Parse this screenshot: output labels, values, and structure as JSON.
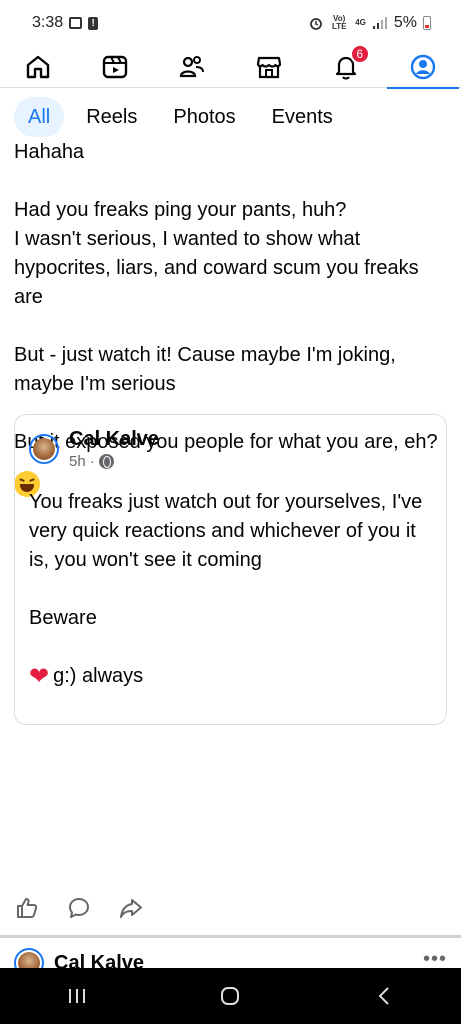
{
  "status_bar": {
    "time": "3:38",
    "network_label": "Vo) LTE",
    "network_type": "4G",
    "battery_percent": "5%"
  },
  "nav": {
    "items": [
      "home-icon",
      "reels-icon",
      "friends-icon",
      "marketplace-icon",
      "notifications-icon",
      "profile-icon"
    ],
    "active": "profile-icon",
    "notification_count": "6",
    "accent_color": "#1877f2"
  },
  "filters": {
    "chips": [
      "All",
      "Reels",
      "Photos",
      "Events"
    ],
    "active": "All"
  },
  "post": {
    "lines": {
      "p0": "Hahaha",
      "p1": "Had you freaks ping your pants, huh?",
      "p2": "I wasn't serious, I wanted to show what hypocrites, liars, and coward scum you freaks are",
      "p3": "But - just watch it! Cause maybe I'm joking,  maybe I'm serious",
      "p4": "But it exposed you people for what you are, eh?"
    },
    "emoji": "laughing-face-emoji"
  },
  "shared_post": {
    "author": "Cal Kalve",
    "time": "5h",
    "separator": "·",
    "lines": {
      "p1": "You freaks just watch out for yourselves, I've very quick reactions and whichever of you it is, you won't see it coming",
      "p2": "Beware",
      "p3": "g:) always"
    },
    "heart": "❤"
  },
  "actions": [
    "like-icon",
    "comment-icon",
    "share-icon"
  ],
  "next_post": {
    "author": "Cal Kalve",
    "more": "•••"
  }
}
